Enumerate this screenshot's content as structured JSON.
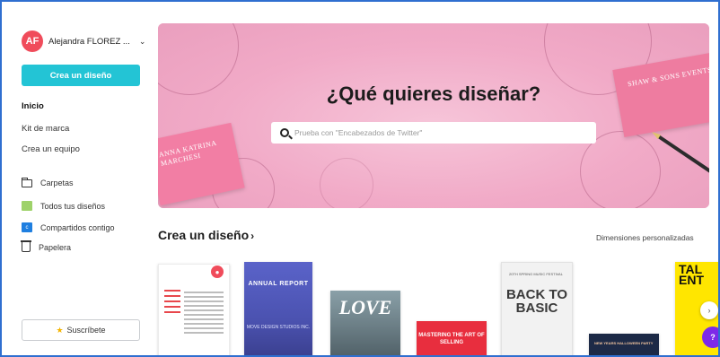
{
  "user": {
    "initials": "AF",
    "name": "Alejandra FLOREZ ..."
  },
  "sidebar": {
    "create_button": "Crea un diseño",
    "nav": [
      "Inicio",
      "Kit de marca",
      "Crea un equipo"
    ],
    "folders": [
      {
        "label": "Carpetas",
        "icon": "folder-icon"
      },
      {
        "label": "Todos tus diseños",
        "icon": "designs-icon"
      },
      {
        "label": "Compartidos contigo",
        "icon": "shared-icon"
      },
      {
        "label": "Papelera",
        "icon": "trash-icon"
      }
    ],
    "subscribe_button": "Suscríbete"
  },
  "hero": {
    "title": "¿Qué quieres diseñar?",
    "search_placeholder": "Prueba con \"Encabezados de Twitter\"",
    "card_left": "ANNA KATRINA MARCHESI",
    "card_right": "SHAW & SONS EVENTS"
  },
  "section": {
    "title": "Crea un diseño",
    "custom_dimensions": "Dimensiones personalizadas"
  },
  "thumbnails": {
    "report": {
      "title": "ANNUAL REPORT",
      "subtitle": "MOVE DESIGN STUDIOS INC."
    },
    "love": "LOVE",
    "master": "MASTERING THE ART OF SELLING",
    "back": {
      "header": "20TH SPRING MUSIC FESTIVAL",
      "title": "BACK TO BASIC"
    },
    "party": "NEW YEARS HALLOWEEN PARTY",
    "talent": "TAL ENT"
  },
  "help_label": "?",
  "colors": {
    "accent": "#23c4d5",
    "avatar": "#f04c5b",
    "hero": "#f1a9c6",
    "help": "#7d2ae8"
  }
}
